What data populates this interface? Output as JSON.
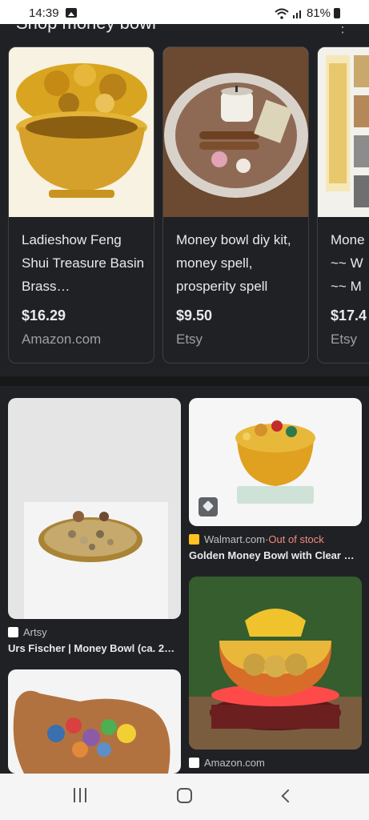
{
  "status_bar": {
    "time": "14:39",
    "battery": "81%"
  },
  "shop_section": {
    "title": "Shop money bowl"
  },
  "products": [
    {
      "title": "Ladieshow Feng Shui Treasure Basin Brass…",
      "price": "$16.29",
      "store": "Amazon.com"
    },
    {
      "title": "Money bowl diy kit, money spell, prosperity spell",
      "price": "$9.50",
      "store": "Etsy"
    },
    {
      "title": "Mone ~~ W ~~ M",
      "price": "$17.4",
      "store": "Etsy"
    }
  ],
  "images": [
    {
      "source": "Artsy",
      "title": "Urs Fischer | Money Bowl (ca. 2…"
    },
    {
      "source": "Walmart.com",
      "status": "Out of stock",
      "separator": " · ",
      "title": "Golden Money Bowl with Clear …"
    },
    {
      "source": "Amazon.com"
    }
  ],
  "colors": {
    "background": "#202124",
    "out_of_stock": "#f28b82",
    "muted": "#9aa0a6"
  }
}
